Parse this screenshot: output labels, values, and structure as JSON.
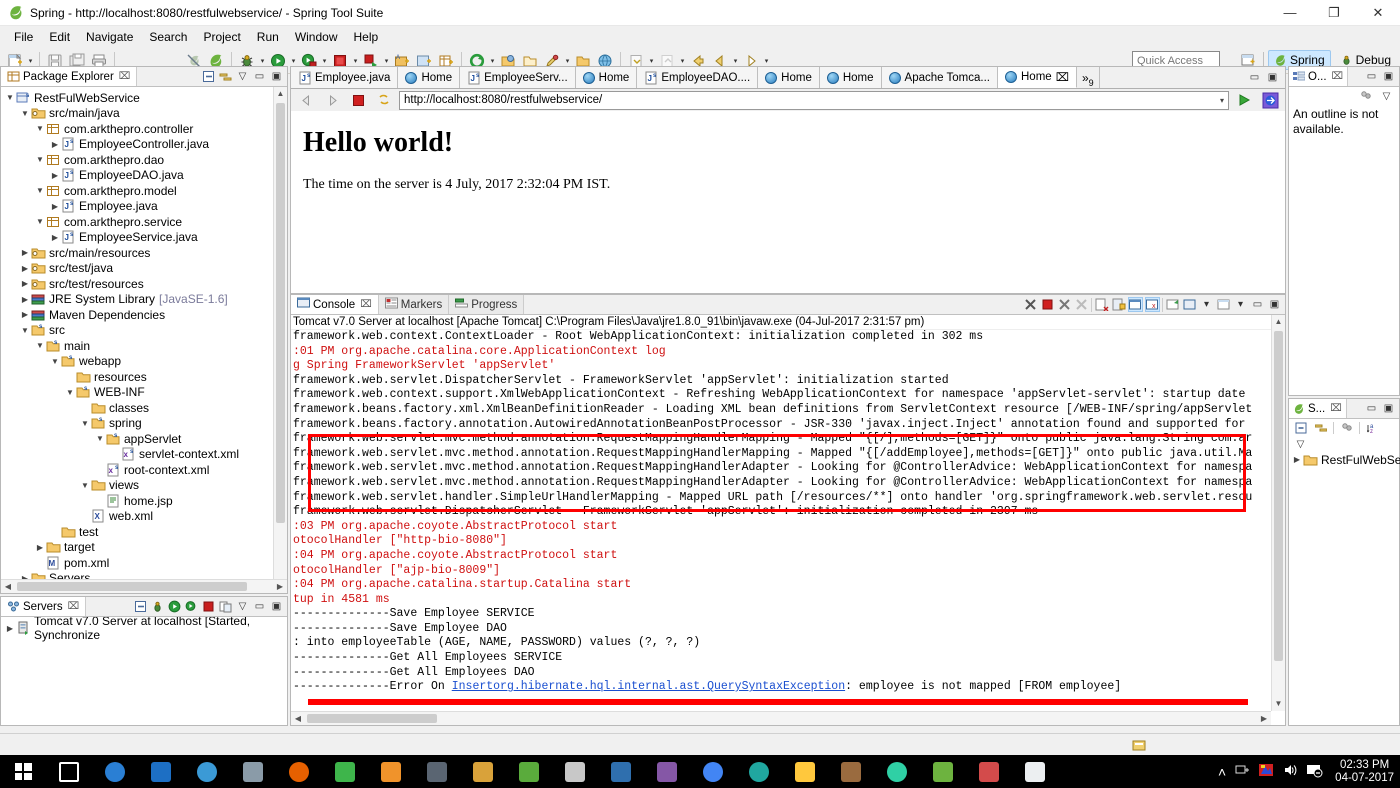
{
  "window": {
    "title": "Spring - http://localhost:8080/restfulwebservice/ - Spring Tool Suite",
    "minimize": "—",
    "maximize": "❐",
    "close": "✕"
  },
  "menu": {
    "items": [
      "File",
      "Edit",
      "Navigate",
      "Search",
      "Project",
      "Run",
      "Window",
      "Help"
    ]
  },
  "toolbar": {
    "quick_access_placeholder": "Quick Access",
    "perspectives": [
      {
        "label": "Spring",
        "active": true
      },
      {
        "label": "Debug",
        "active": false
      }
    ]
  },
  "package_explorer": {
    "tab_label": "Package Explorer",
    "close_glyph": "⌧",
    "tree": [
      {
        "depth": 0,
        "twist": "v",
        "icon": "project-icon",
        "label": "RestFulWebService",
        "extra": ""
      },
      {
        "depth": 1,
        "twist": "v",
        "icon": "source-folder-icon",
        "label": "src/main/java",
        "extra": ""
      },
      {
        "depth": 2,
        "twist": "v",
        "icon": "package-icon",
        "label": "com.arkthepro.controller",
        "extra": ""
      },
      {
        "depth": 3,
        "twist": ">",
        "icon": "java-file-icon",
        "label": "EmployeeController.java",
        "extra": ""
      },
      {
        "depth": 2,
        "twist": "v",
        "icon": "package-icon",
        "label": "com.arkthepro.dao",
        "extra": ""
      },
      {
        "depth": 3,
        "twist": ">",
        "icon": "java-file-icon",
        "label": "EmployeeDAO.java",
        "extra": ""
      },
      {
        "depth": 2,
        "twist": "v",
        "icon": "package-icon",
        "label": "com.arkthepro.model",
        "extra": ""
      },
      {
        "depth": 3,
        "twist": ">",
        "icon": "java-file-icon",
        "label": "Employee.java",
        "extra": ""
      },
      {
        "depth": 2,
        "twist": "v",
        "icon": "package-icon",
        "label": "com.arkthepro.service",
        "extra": ""
      },
      {
        "depth": 3,
        "twist": ">",
        "icon": "java-file-icon",
        "label": "EmployeeService.java",
        "extra": ""
      },
      {
        "depth": 1,
        "twist": ">",
        "icon": "source-folder-icon",
        "label": "src/main/resources",
        "extra": ""
      },
      {
        "depth": 1,
        "twist": ">",
        "icon": "source-folder-icon",
        "label": "src/test/java",
        "extra": ""
      },
      {
        "depth": 1,
        "twist": ">",
        "icon": "source-folder-icon",
        "label": "src/test/resources",
        "extra": ""
      },
      {
        "depth": 1,
        "twist": ">",
        "icon": "library-icon",
        "label": "JRE System Library",
        "extra": "[JavaSE-1.6]"
      },
      {
        "depth": 1,
        "twist": ">",
        "icon": "library-icon",
        "label": "Maven Dependencies",
        "extra": ""
      },
      {
        "depth": 1,
        "twist": "v",
        "icon": "folder-s-icon",
        "label": "src",
        "extra": ""
      },
      {
        "depth": 2,
        "twist": "v",
        "icon": "folder-s-icon",
        "label": "main",
        "extra": ""
      },
      {
        "depth": 3,
        "twist": "v",
        "icon": "folder-s-icon",
        "label": "webapp",
        "extra": ""
      },
      {
        "depth": 4,
        "twist": "",
        "icon": "folder-icon",
        "label": "resources",
        "extra": ""
      },
      {
        "depth": 4,
        "twist": "v",
        "icon": "folder-s-icon",
        "label": "WEB-INF",
        "extra": ""
      },
      {
        "depth": 5,
        "twist": "",
        "icon": "folder-icon",
        "label": "classes",
        "extra": ""
      },
      {
        "depth": 5,
        "twist": "v",
        "icon": "folder-s-icon",
        "label": "spring",
        "extra": ""
      },
      {
        "depth": 6,
        "twist": "v",
        "icon": "folder-s-icon",
        "label": "appServlet",
        "extra": ""
      },
      {
        "depth": 7,
        "twist": "",
        "icon": "xml-icon",
        "label": "servlet-context.xml",
        "extra": ""
      },
      {
        "depth": 6,
        "twist": "",
        "icon": "xml-icon",
        "label": "root-context.xml",
        "extra": ""
      },
      {
        "depth": 5,
        "twist": "v",
        "icon": "folder-icon",
        "label": "views",
        "extra": ""
      },
      {
        "depth": 6,
        "twist": "",
        "icon": "jsp-icon",
        "label": "home.jsp",
        "extra": ""
      },
      {
        "depth": 5,
        "twist": "",
        "icon": "xml-file-icon",
        "label": "web.xml",
        "extra": ""
      },
      {
        "depth": 3,
        "twist": "",
        "icon": "folder-icon",
        "label": "test",
        "extra": ""
      },
      {
        "depth": 2,
        "twist": ">",
        "icon": "folder-icon",
        "label": "target",
        "extra": ""
      },
      {
        "depth": 2,
        "twist": "",
        "icon": "maven-icon",
        "label": "pom.xml",
        "extra": ""
      },
      {
        "depth": 1,
        "twist": ">",
        "icon": "folder-icon",
        "label": "Servers",
        "extra": ""
      }
    ]
  },
  "servers_view": {
    "tab_label": "Servers",
    "close_glyph": "⌧",
    "rows": [
      {
        "twist": ">",
        "label": "Tomcat v7.0 Server at localhost  [Started, Synchronize"
      }
    ]
  },
  "editor": {
    "tabs": [
      {
        "label": "Employee.java",
        "icon": "java-file-icon",
        "active": false,
        "closeable": false
      },
      {
        "label": "Home",
        "icon": "globe-icon",
        "active": false,
        "closeable": false
      },
      {
        "label": "EmployeeServ...",
        "icon": "java-file-icon",
        "active": false,
        "closeable": false
      },
      {
        "label": "Home",
        "icon": "globe-icon",
        "active": false,
        "closeable": false
      },
      {
        "label": "EmployeeDAO....",
        "icon": "java-file-icon",
        "active": false,
        "closeable": false
      },
      {
        "label": "Home",
        "icon": "globe-icon",
        "active": false,
        "closeable": false
      },
      {
        "label": "Home",
        "icon": "globe-icon",
        "active": false,
        "closeable": false
      },
      {
        "label": "Apache Tomca...",
        "icon": "globe-icon",
        "active": false,
        "closeable": false
      },
      {
        "label": "Home",
        "icon": "globe-icon",
        "active": true,
        "closeable": true
      }
    ],
    "more_tabs": "»",
    "more_tabs_count": "9",
    "close_glyph": "⌧"
  },
  "browser": {
    "url": "http://localhost:8080/restfulwebservice/",
    "back_icon": "back-arrow-icon",
    "forward_icon": "forward-arrow-icon",
    "stop_icon": "stop-icon",
    "refresh_icon": "refresh-icon",
    "dropdown_glyph": "▾",
    "go_icon": "go-icon",
    "open_external_icon": "open-external-icon",
    "heading": "Hello world!",
    "body_text": "The time on the server is 4 July, 2017 2:32:04 PM IST."
  },
  "outline_view": {
    "tab_label": "O...",
    "close_glyph": "⌧",
    "message": "An outline is not available."
  },
  "spring_explorer": {
    "tab_label": "S...",
    "close_glyph": "⌧",
    "rows": [
      {
        "twist": ">",
        "label": "RestFulWebSer"
      }
    ]
  },
  "console": {
    "tabs": [
      {
        "label": "Console",
        "active": true,
        "icon": "console-icon",
        "closeable": true
      },
      {
        "label": "Markers",
        "active": false,
        "icon": "markers-icon",
        "closeable": false
      },
      {
        "label": "Progress",
        "active": false,
        "icon": "progress-icon",
        "closeable": false
      }
    ],
    "close_glyph": "⌧",
    "header": "Tomcat v7.0 Server at localhost [Apache Tomcat] C:\\Program Files\\Java\\jre1.8.0_91\\bin\\javaw.exe (04-Jul-2017 2:31:57 pm)",
    "lines": [
      {
        "color": "black",
        "text": "framework.web.context.ContextLoader - Root WebApplicationContext: initialization completed in 302 ms"
      },
      {
        "color": "red",
        "text": ":01 PM org.apache.catalina.core.ApplicationContext log"
      },
      {
        "color": "red",
        "text": "g Spring FrameworkServlet 'appServlet'"
      },
      {
        "color": "black",
        "text": "framework.web.servlet.DispatcherServlet - FrameworkServlet 'appServlet': initialization started"
      },
      {
        "color": "black",
        "text": "framework.web.context.support.XmlWebApplicationContext - Refreshing WebApplicationContext for namespace 'appServlet-servlet': startup date"
      },
      {
        "color": "black",
        "text": "framework.beans.factory.xml.XmlBeanDefinitionReader - Loading XML bean definitions from ServletContext resource [/WEB-INF/spring/appServlet"
      },
      {
        "color": "black",
        "text": "framework.beans.factory.annotation.AutowiredAnnotationBeanPostProcessor - JSR-330 'javax.inject.Inject' annotation found and supported for"
      },
      {
        "color": "black",
        "text": "framework.web.servlet.mvc.method.annotation.RequestMappingHandlerMapping - Mapped \"{[/],methods=[GET]}\" onto public java.lang.String com.ar"
      },
      {
        "color": "black",
        "text": "framework.web.servlet.mvc.method.annotation.RequestMappingHandlerMapping - Mapped \"{[/addEmployee],methods=[GET]}\" onto public java.util.Ma"
      },
      {
        "color": "black",
        "text": "framework.web.servlet.mvc.method.annotation.RequestMappingHandlerAdapter - Looking for @ControllerAdvice: WebApplicationContext for namespa"
      },
      {
        "color": "black",
        "text": "framework.web.servlet.mvc.method.annotation.RequestMappingHandlerAdapter - Looking for @ControllerAdvice: WebApplicationContext for namespa"
      },
      {
        "color": "black",
        "text": "framework.web.servlet.handler.SimpleUrlHandlerMapping - Mapped URL path [/resources/**] onto handler 'org.springframework.web.servlet.resou"
      },
      {
        "color": "black",
        "text": "framework.web.servlet.DispatcherServlet - FrameworkServlet 'appServlet': initialization completed in 2397 ms"
      },
      {
        "color": "red",
        "text": ":03 PM org.apache.coyote.AbstractProtocol start"
      },
      {
        "color": "red",
        "text": "otocolHandler [\"http-bio-8080\"]"
      },
      {
        "color": "red",
        "text": ":04 PM org.apache.coyote.AbstractProtocol start"
      },
      {
        "color": "red",
        "text": "otocolHandler [\"ajp-bio-8009\"]"
      },
      {
        "color": "red",
        "text": ":04 PM org.apache.catalina.startup.Catalina start"
      },
      {
        "color": "red",
        "text": "tup in 4581 ms"
      },
      {
        "color": "black",
        "text": "--------------Save Employee SERVICE"
      },
      {
        "color": "black",
        "text": "--------------Save Employee DAO"
      },
      {
        "color": "black",
        "text": ": into employeeTable (AGE, NAME, PASSWORD) values (?, ?, ?)"
      },
      {
        "color": "black",
        "text": "--------------Get All Employees SERVICE"
      },
      {
        "color": "black",
        "text": "--------------Get All Employees DAO"
      }
    ],
    "error_line": {
      "prefix": "--------------Error On ",
      "link": "Insertorg.hibernate.hql.internal.ast.QuerySyntaxException",
      "suffix": ": employee is not mapped [FROM employee]"
    }
  },
  "taskbar": {
    "start_icon": "windows-start-icon",
    "apps": [
      {
        "name": "task-view-icon",
        "color": "#ffffff"
      },
      {
        "name": "edge-icon",
        "color": "#2a7fd4"
      },
      {
        "name": "store-icon",
        "color": "#1d6fc4"
      },
      {
        "name": "browser-icon",
        "color": "#3b9ad6"
      },
      {
        "name": "notes-icon",
        "color": "#8a9ba8"
      },
      {
        "name": "firefox-icon",
        "color": "#e66000"
      },
      {
        "name": "media-icon",
        "color": "#3eb54b"
      },
      {
        "name": "orange-app-icon",
        "color": "#f0932b"
      },
      {
        "name": "bar-icon",
        "color": "#5a6572"
      },
      {
        "name": "folder-app-icon",
        "color": "#d9a23a"
      },
      {
        "name": "green-app-icon",
        "color": "#5aab3c"
      },
      {
        "name": "sql-icon",
        "color": "#c8c8c8"
      },
      {
        "name": "blue-app-icon",
        "color": "#2f6fae"
      },
      {
        "name": "purple-app-icon",
        "color": "#8557a6"
      },
      {
        "name": "chrome-icon",
        "color": "#4285f4"
      },
      {
        "name": "teal-app-icon",
        "color": "#20a7a0"
      },
      {
        "name": "explorer-icon",
        "color": "#ffc83d"
      },
      {
        "name": "brown-app-icon",
        "color": "#9a6b3f"
      },
      {
        "name": "mint-icon",
        "color": "#2fd0a5"
      },
      {
        "name": "sts-icon",
        "color": "#6db33f"
      },
      {
        "name": "paint-icon",
        "color": "#d34b4b"
      },
      {
        "name": "photos-icon",
        "color": "#eceff1"
      }
    ],
    "tray": {
      "chevron": "˄",
      "network_icon": "network-icon",
      "app_icon": "tray-app-icon",
      "volume_icon": "volume-icon",
      "notification_icon": "notification-icon",
      "time": "02:33 PM",
      "date": "04-07-2017"
    }
  }
}
